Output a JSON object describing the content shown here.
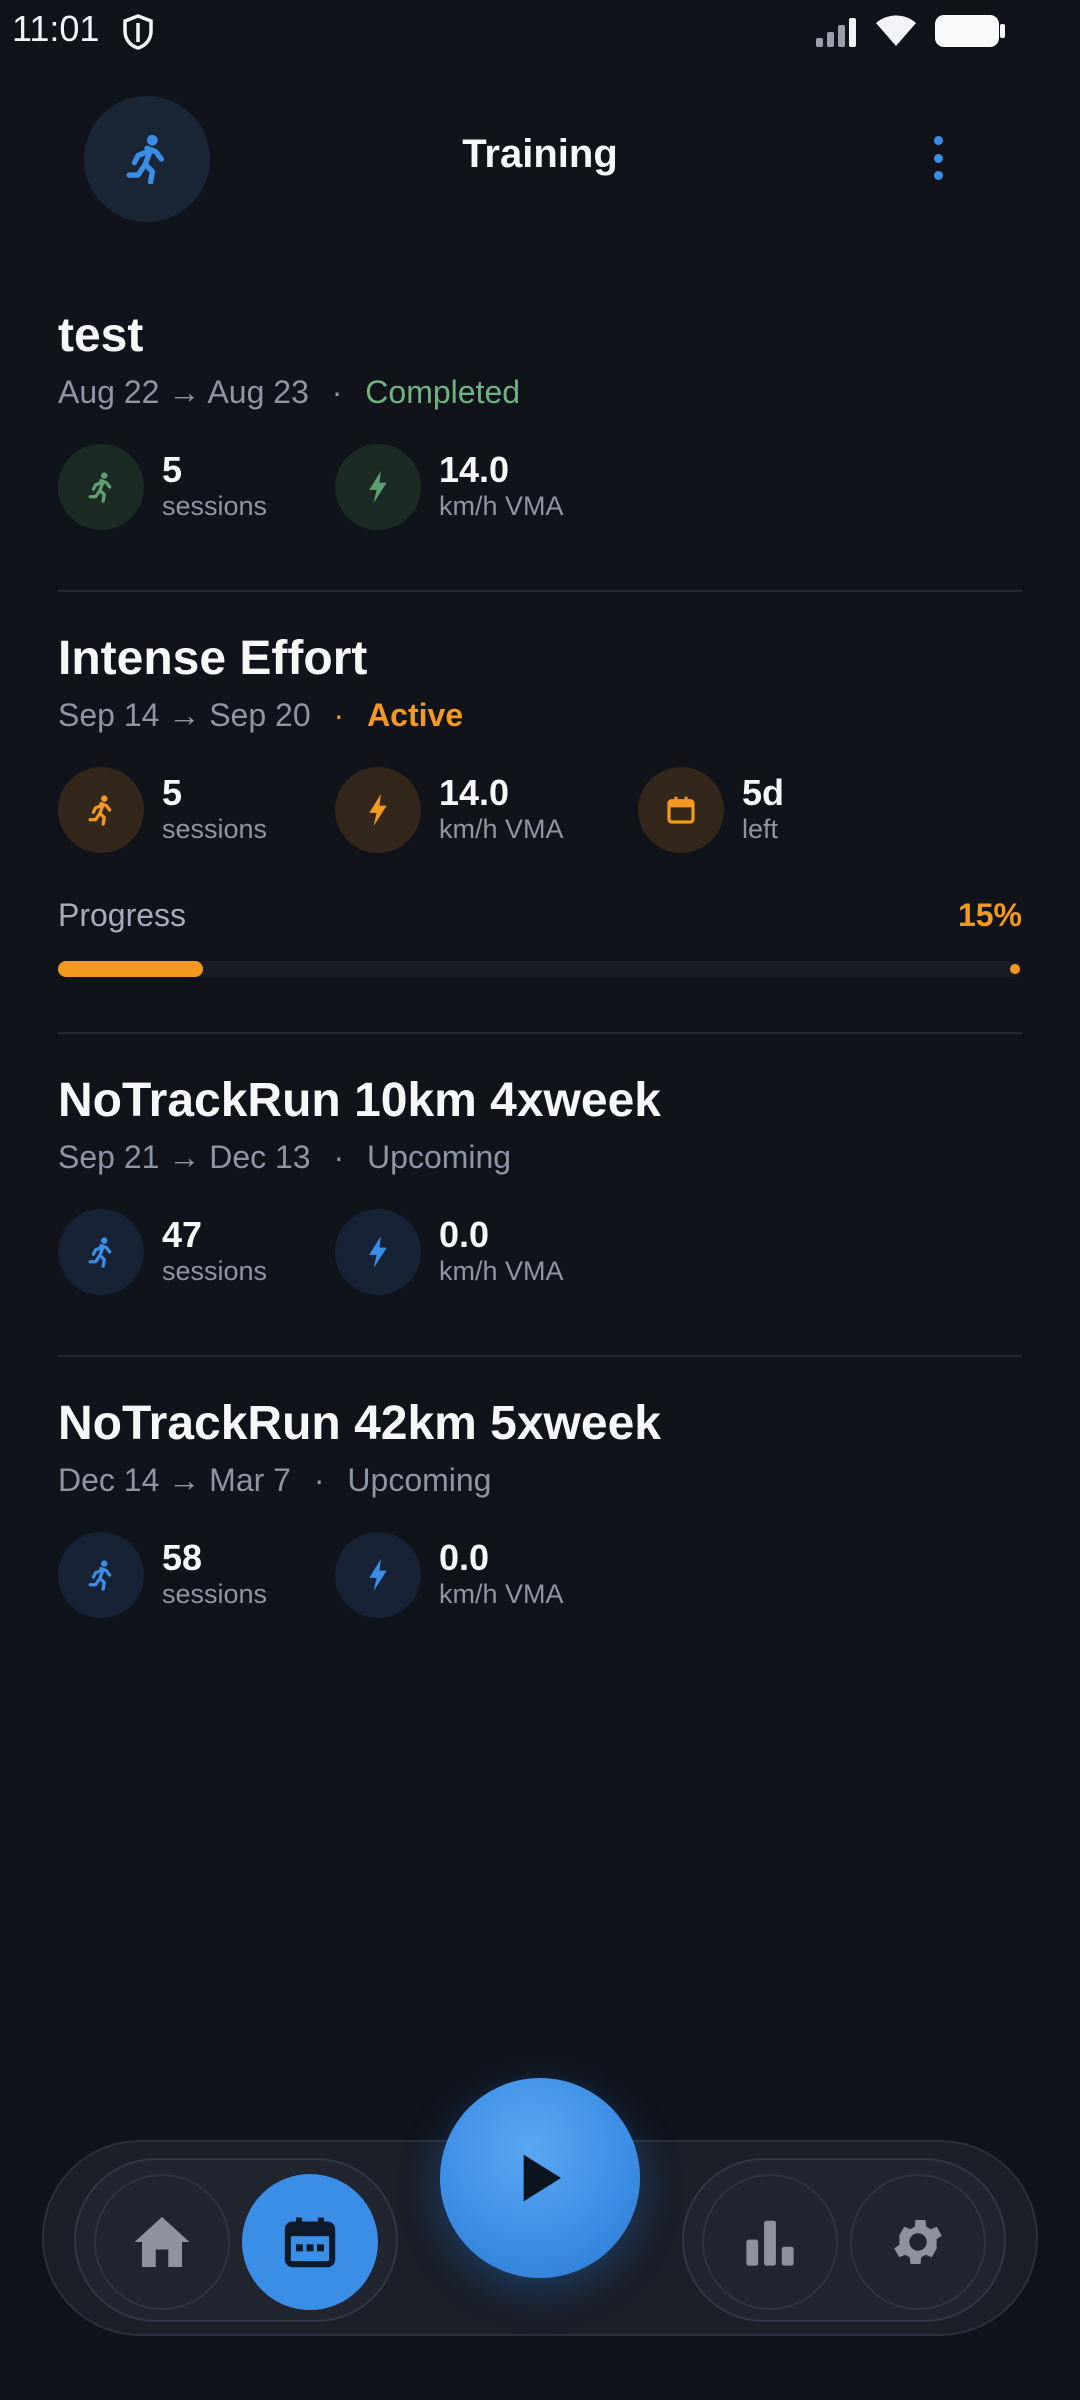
{
  "status_bar": {
    "time": "11:01"
  },
  "header": {
    "title": "Training"
  },
  "plans": [
    {
      "title": "test",
      "start": "Aug 22",
      "arrow": "→",
      "end": "Aug 23",
      "sep": "·",
      "status": "Completed",
      "stats": [
        {
          "value": "5",
          "unit": "sessions",
          "icon": "runner-icon"
        },
        {
          "value": "14.0",
          "unit": "km/h VMA",
          "icon": "bolt-icon"
        }
      ]
    },
    {
      "title": "Intense Effort",
      "start": "Sep 14",
      "arrow": "→",
      "end": "Sep 20",
      "sep": "·",
      "status": "Active",
      "stats": [
        {
          "value": "5",
          "unit": "sessions",
          "icon": "runner-icon"
        },
        {
          "value": "14.0",
          "unit": "km/h VMA",
          "icon": "bolt-icon"
        },
        {
          "value": "5d",
          "unit": "left",
          "icon": "calendar-icon"
        }
      ],
      "progress": {
        "label": "Progress",
        "percent_text": "15%",
        "value": 0.15
      }
    },
    {
      "title": "NoTrackRun 10km 4xweek",
      "start": "Sep 21",
      "arrow": "→",
      "end": "Dec 13",
      "sep": "·",
      "status": "Upcoming",
      "stats": [
        {
          "value": "47",
          "unit": "sessions",
          "icon": "runner-icon"
        },
        {
          "value": "0.0",
          "unit": "km/h VMA",
          "icon": "bolt-icon"
        }
      ]
    },
    {
      "title": "NoTrackRun 42km 5xweek",
      "start": "Dec 14",
      "arrow": "→",
      "end": "Mar 7",
      "sep": "·",
      "status": "Upcoming",
      "stats": [
        {
          "value": "58",
          "unit": "sessions",
          "icon": "runner-icon"
        },
        {
          "value": "0.0",
          "unit": "km/h VMA",
          "icon": "bolt-icon"
        }
      ]
    }
  ],
  "bottom_nav": {
    "items": [
      "home-icon",
      "calendar-icon",
      "play-icon",
      "bar-chart-icon",
      "gear-icon"
    ],
    "active": "calendar-icon"
  },
  "colors": {
    "background": "#10131a",
    "accent_blue": "#3a8ee6",
    "active_orange": "#f3991f",
    "completed_green": "#6fb382",
    "muted_text": "#8e95a3"
  }
}
